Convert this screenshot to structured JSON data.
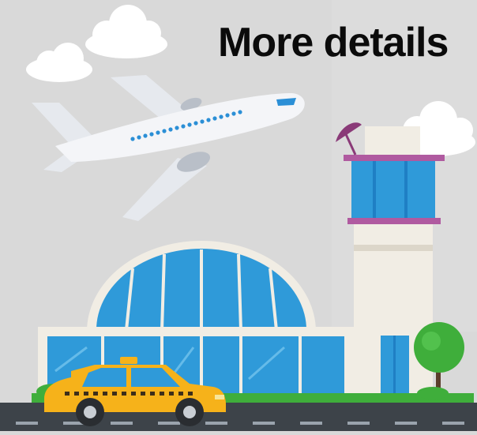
{
  "headline": "More details",
  "palette": {
    "background": "#d9d9d9",
    "glass": "#3aa7e0",
    "glass_dark": "#1f7fc4",
    "building": "#f1ede4",
    "taxi": "#f6b21a",
    "tower_trim": "#b05aa0",
    "tree": "#3fae3b",
    "road": "#3d4349"
  },
  "illustration": {
    "subject": "airport-scene",
    "elements": [
      "clouds",
      "airplane",
      "terminal-building",
      "control-tower",
      "radar-dish",
      "taxi",
      "tree",
      "road"
    ]
  }
}
